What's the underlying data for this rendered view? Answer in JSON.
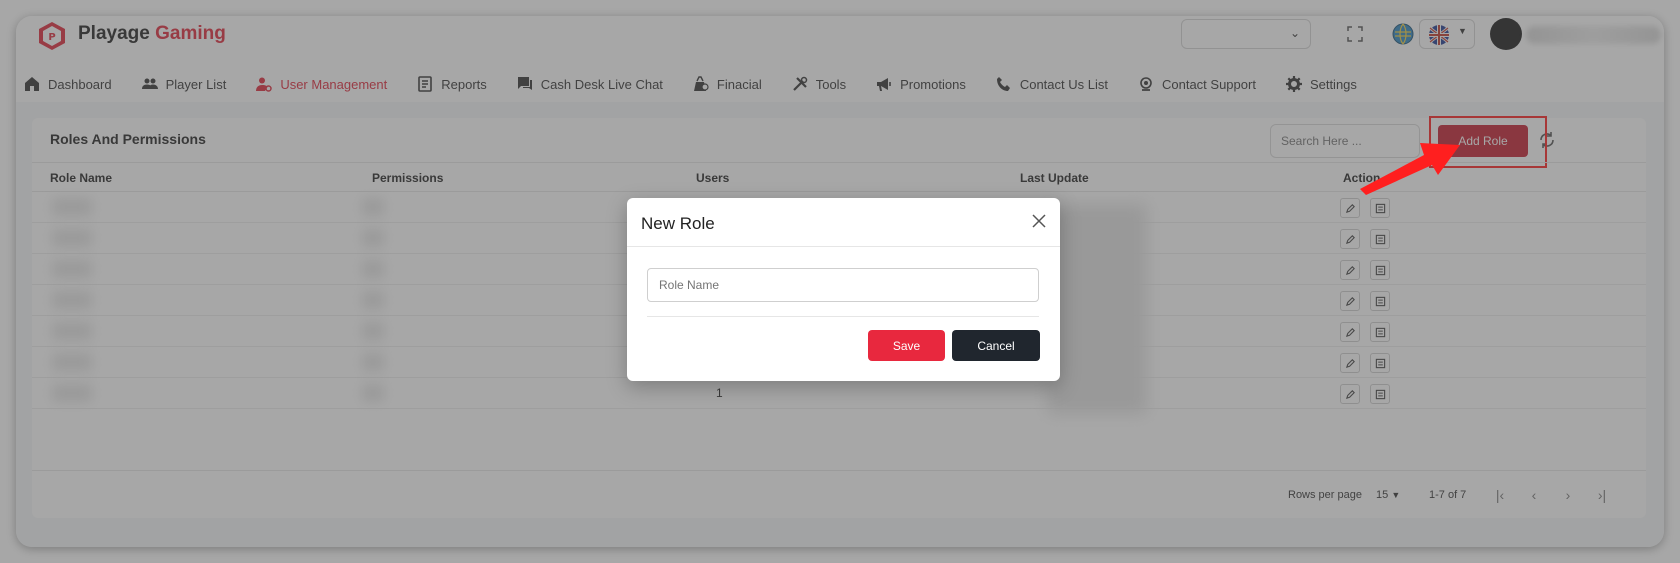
{
  "brand": {
    "name": "Playage",
    "accent_name": "Gaming",
    "accent_color": "#e0283b"
  },
  "nav": {
    "items": [
      {
        "label": "Dashboard",
        "icon": "home-icon"
      },
      {
        "label": "Player List",
        "icon": "users-icon"
      },
      {
        "label": "User Management",
        "icon": "user-cog-icon",
        "active": true
      },
      {
        "label": "Reports",
        "icon": "reports-icon"
      },
      {
        "label": "Cash Desk Live Chat",
        "icon": "chat-icon"
      },
      {
        "label": "Finacial",
        "icon": "financial-icon"
      },
      {
        "label": "Tools",
        "icon": "tools-icon"
      },
      {
        "label": "Promotions",
        "icon": "megaphone-icon"
      },
      {
        "label": "Contact Us List",
        "icon": "phone-icon"
      },
      {
        "label": "Contact Support",
        "icon": "support-icon"
      },
      {
        "label": "Settings",
        "icon": "gear-icon"
      }
    ]
  },
  "card": {
    "title": "Roles And Permissions",
    "search_placeholder": "Search Here ...",
    "add_role_label": "Add Role",
    "columns": [
      "Role Name",
      "Permissions",
      "Users",
      "Last Update",
      "Action"
    ],
    "rows_visible_users_last": "1",
    "row_count": 7
  },
  "footer": {
    "rows_per_page_label": "Rows per page",
    "rows_per_page_value": "15",
    "range": "1-7 of 7"
  },
  "modal": {
    "title": "New Role",
    "input_placeholder": "Role Name",
    "save_label": "Save",
    "cancel_label": "Cancel"
  },
  "colors": {
    "primary_red": "#e8283e",
    "dark_button": "#20262e",
    "highlight": "#ff1f1f"
  }
}
